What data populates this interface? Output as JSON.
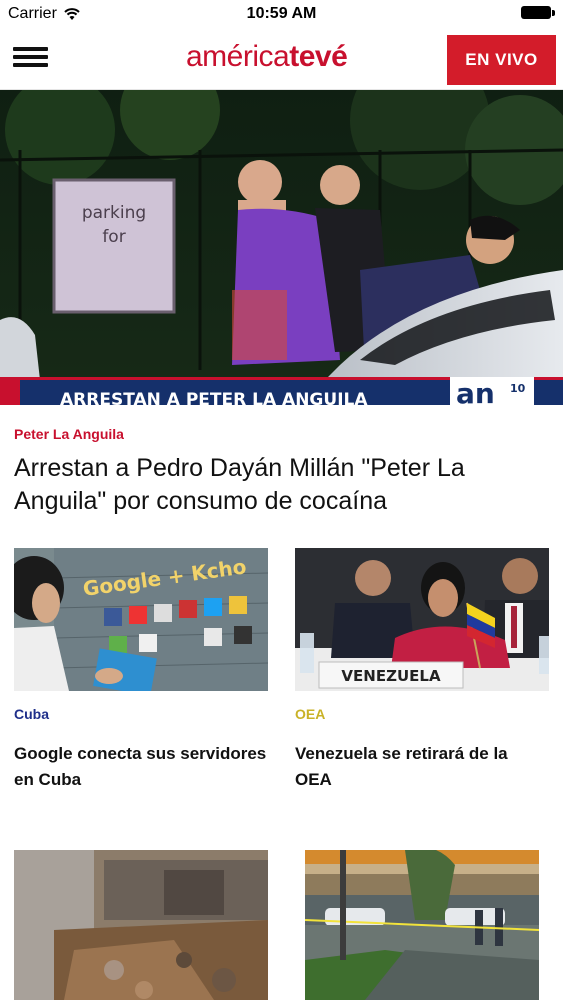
{
  "status_bar": {
    "carrier": "Carrier",
    "time": "10:59 AM"
  },
  "header": {
    "logo_part1": "américa",
    "logo_part2": "tevé",
    "live_label": "EN VIVO"
  },
  "hero": {
    "image_caption": "ARRESTAN A PETER LA ANGUILA",
    "kicker": "Peter La Anguila",
    "title": "Arrestan a Pedro Dayán Millán \"Peter La Anguila\" por consumo de cocaína"
  },
  "articles": [
    {
      "kicker": "Cuba",
      "kicker_color": "#1f2f8a",
      "title": "Google conecta sus servidores en Cuba"
    },
    {
      "kicker": "OEA",
      "kicker_color": "#c9b227",
      "title": "Venezuela se retirará de la OEA",
      "image_placard": "VENEZUELA"
    },
    {
      "kicker": "",
      "title": ""
    },
    {
      "kicker": "",
      "title": ""
    }
  ],
  "colors": {
    "brand": "#c8102e",
    "live_button": "#d31c2a"
  }
}
